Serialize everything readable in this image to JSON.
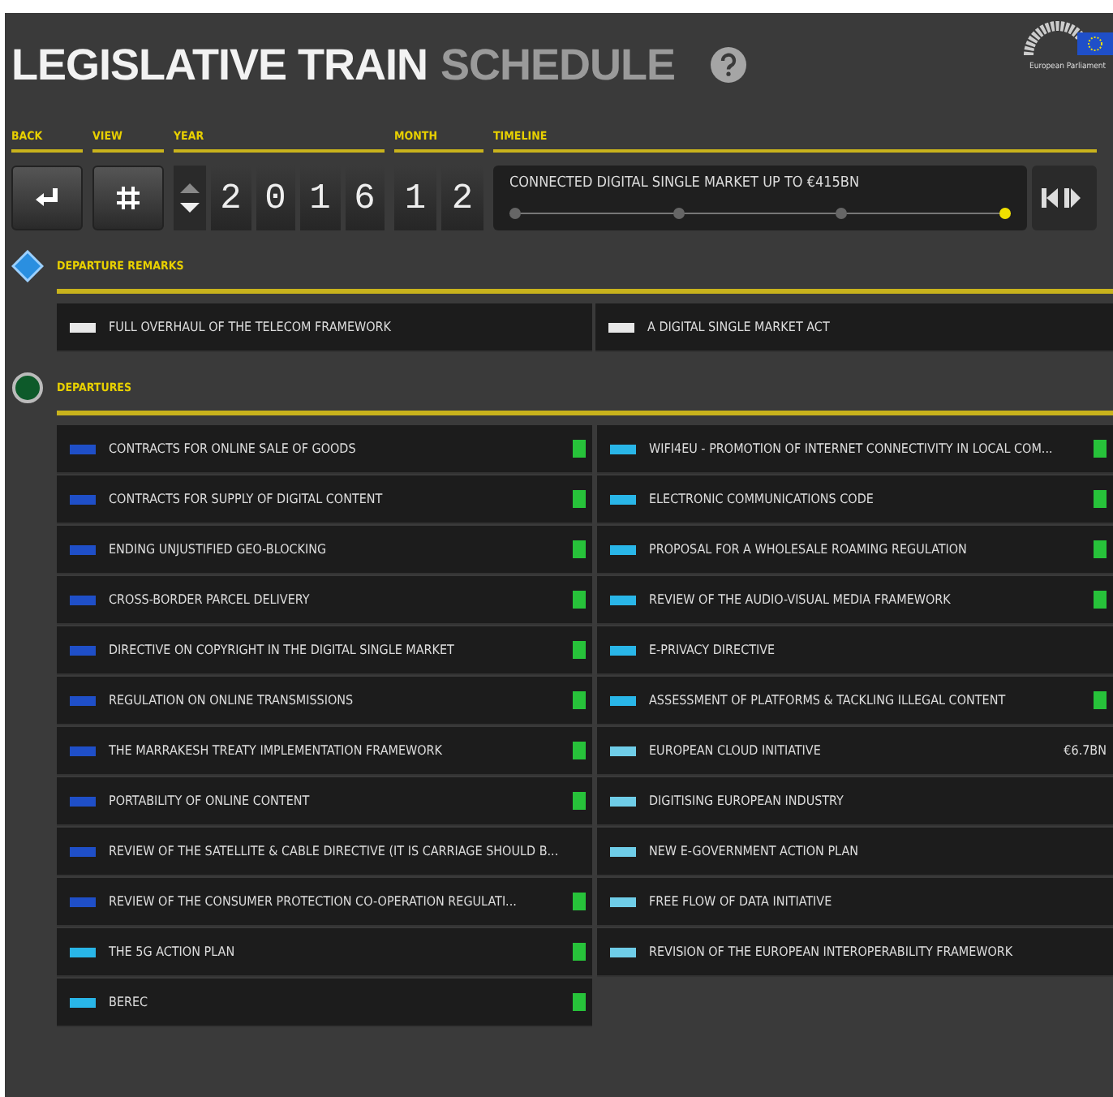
{
  "header": {
    "title_main": "LEGISLATIVE TRAIN",
    "title_sub": "SCHEDULE",
    "logo_caption": "European Parliament"
  },
  "controls": {
    "back_label": "BACK",
    "view_label": "VIEW",
    "year_label": "YEAR",
    "month_label": "MONTH",
    "timeline_label": "TIMELINE",
    "year_digits": [
      "2",
      "0",
      "1",
      "6"
    ],
    "month_digits": [
      "1",
      "2"
    ],
    "timeline": {
      "caption": "CONNECTED DIGITAL SINGLE MARKET UP TO €415BN",
      "stops": [
        {
          "selected": false
        },
        {
          "selected": false
        },
        {
          "selected": false
        },
        {
          "selected": true
        }
      ]
    }
  },
  "remarks": {
    "title": "DEPARTURE REMARKS",
    "items": [
      {
        "label": "FULL OVERHAUL OF THE TELECOM FRAMEWORK",
        "color": "#e8e8e8"
      },
      {
        "label": "A DIGITAL SINGLE MARKET ACT",
        "color": "#e8e8e8"
      }
    ]
  },
  "departures": {
    "title": "DEPARTURES",
    "columns": [
      [
        {
          "label": "CONTRACTS FOR ONLINE SALE OF GOODS",
          "color": "#1f4fc8",
          "badge": true
        },
        {
          "label": "CONTRACTS FOR SUPPLY OF DIGITAL CONTENT",
          "color": "#1f4fc8",
          "badge": true
        },
        {
          "label": "ENDING UNJUSTIFIED GEO-BLOCKING",
          "color": "#1f4fc8",
          "badge": true
        },
        {
          "label": "CROSS-BORDER PARCEL DELIVERY",
          "color": "#1f4fc8",
          "badge": true
        },
        {
          "label": "DIRECTIVE ON COPYRIGHT IN THE DIGITAL SINGLE MARKET",
          "color": "#1f4fc8",
          "badge": true
        },
        {
          "label": "REGULATION ON ONLINE TRANSMISSIONS",
          "color": "#1f4fc8",
          "badge": true
        },
        {
          "label": "THE MARRAKESH TREATY IMPLEMENTATION FRAMEWORK",
          "color": "#1f4fc8",
          "badge": true
        },
        {
          "label": "PORTABILITY OF ONLINE CONTENT",
          "color": "#1f4fc8",
          "badge": true
        },
        {
          "label": "REVIEW OF THE SATELLITE & CABLE DIRECTIVE (IT IS CARRIAGE SHOULD B...",
          "color": "#1f4fc8",
          "badge": false
        },
        {
          "label": "REVIEW OF THE CONSUMER PROTECTION CO-OPERATION REGULATI...",
          "color": "#1f4fc8",
          "badge": true
        },
        {
          "label": "THE 5G ACTION PLAN",
          "color": "#29b6e8",
          "badge": true
        },
        {
          "label": "BEREC",
          "color": "#29b6e8",
          "badge": true
        }
      ],
      [
        {
          "label": "WIFI4EU - PROMOTION OF INTERNET CONNECTIVITY IN LOCAL COM...",
          "color": "#29b6e8",
          "badge": true
        },
        {
          "label": "ELECTRONIC COMMUNICATIONS CODE",
          "color": "#29b6e8",
          "badge": true
        },
        {
          "label": "PROPOSAL FOR A WHOLESALE ROAMING REGULATION",
          "color": "#29b6e8",
          "badge": true
        },
        {
          "label": "REVIEW OF THE AUDIO-VISUAL MEDIA FRAMEWORK",
          "color": "#29b6e8",
          "badge": true
        },
        {
          "label": "E-PRIVACY DIRECTIVE",
          "color": "#29b6e8",
          "badge": false
        },
        {
          "label": "ASSESSMENT OF PLATFORMS & TACKLING ILLEGAL CONTENT",
          "color": "#29b6e8",
          "badge": true
        },
        {
          "label": "EUROPEAN CLOUD INITIATIVE",
          "color": "#6fcde8",
          "badge": false,
          "amount": "€6.7BN"
        },
        {
          "label": "DIGITISING EUROPEAN INDUSTRY",
          "color": "#6fcde8",
          "badge": false
        },
        {
          "label": "NEW E-GOVERNMENT ACTION PLAN",
          "color": "#6fcde8",
          "badge": false
        },
        {
          "label": "FREE FLOW OF DATA INITIATIVE",
          "color": "#6fcde8",
          "badge": false
        },
        {
          "label": "REVISION OF THE EUROPEAN INTEROPERABILITY FRAMEWORK",
          "color": "#6fcde8",
          "badge": false
        }
      ]
    ]
  }
}
